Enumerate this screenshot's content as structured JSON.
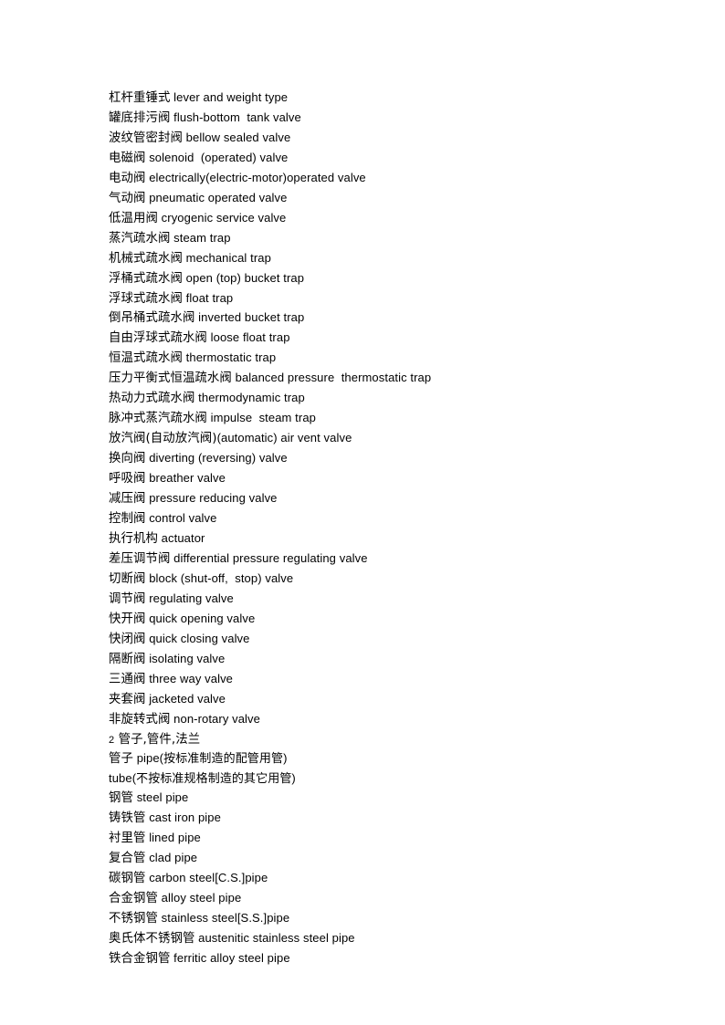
{
  "document": {
    "background_color": "#ffffff",
    "text_color": "#000000",
    "lines": [
      {
        "term": "杠杆重锤式",
        "gloss": " lever and weight type"
      },
      {
        "term": "罐底排污阀",
        "gloss": " flush-bottom  tank valve"
      },
      {
        "term": "波纹管密封阀",
        "gloss": " bellow sealed valve"
      },
      {
        "term": "电磁阀",
        "gloss": " solenoid  (operated) valve"
      },
      {
        "term": "电动阀",
        "gloss": " electrically(electric-motor)operated valve"
      },
      {
        "term": "气动阀",
        "gloss": " pneumatic operated valve"
      },
      {
        "term": "低温用阀",
        "gloss": " cryogenic service valve"
      },
      {
        "term": "蒸汽疏水阀",
        "gloss": " steam trap"
      },
      {
        "term": "机械式疏水阀",
        "gloss": " mechanical trap"
      },
      {
        "term": "浮桶式疏水阀",
        "gloss": " open (top) bucket trap"
      },
      {
        "term": "浮球式疏水阀",
        "gloss": " float trap"
      },
      {
        "term": "倒吊桶式疏水阀",
        "gloss": " inverted bucket trap"
      },
      {
        "term": "自由浮球式疏水阀",
        "gloss": " loose float trap"
      },
      {
        "term": "恒温式疏水阀",
        "gloss": " thermostatic trap"
      },
      {
        "term": "压力平衡式恒温疏水阀",
        "gloss": " balanced pressure  thermostatic trap"
      },
      {
        "term": "热动力式疏水阀",
        "gloss": " thermodynamic trap"
      },
      {
        "term": "脉冲式蒸汽疏水阀",
        "gloss": " impulse  steam trap"
      },
      {
        "term": "放汽阀(自动放汽阀)",
        "gloss": "(automatic) air vent valve"
      },
      {
        "term": "换向阀",
        "gloss": " diverting (reversing) valve"
      },
      {
        "term": "呼吸阀",
        "gloss": " breather valve"
      },
      {
        "term": "减压阀",
        "gloss": " pressure reducing valve"
      },
      {
        "term": "控制阀",
        "gloss": " control valve"
      },
      {
        "term": "执行机构",
        "gloss": " actuator"
      },
      {
        "term": "差压调节阀",
        "gloss": " differential pressure regulating valve"
      },
      {
        "term": "切断阀",
        "gloss": " block (shut-off,  stop) valve"
      },
      {
        "term": "调节阀",
        "gloss": " regulating valve"
      },
      {
        "term": "快开阀",
        "gloss": " quick opening valve"
      },
      {
        "term": "快闭阀",
        "gloss": " quick closing valve"
      },
      {
        "term": "隔断阀",
        "gloss": " isolating valve"
      },
      {
        "term": "三通阀",
        "gloss": " three way valve"
      },
      {
        "term": "夹套阀",
        "gloss": " jacketed valve"
      },
      {
        "term": "非旋转式阀",
        "gloss": " non-rotary valve"
      },
      {
        "heading": true,
        "number": "2",
        "term": " 管子,管件,法兰",
        "gloss": ""
      },
      {
        "term": "管子",
        "gloss": " pipe(按标准制造的配管用管)"
      },
      {
        "term": "",
        "gloss": "tube(不按标准规格制造的其它用管)"
      },
      {
        "term": "钢管",
        "gloss": " steel pipe"
      },
      {
        "term": "铸铁管",
        "gloss": " cast iron pipe"
      },
      {
        "term": "衬里管",
        "gloss": " lined pipe"
      },
      {
        "term": "复合管",
        "gloss": " clad pipe"
      },
      {
        "term": "碳钢管",
        "gloss": " carbon steel[C.S.]pipe"
      },
      {
        "term": "合金钢管",
        "gloss": " alloy steel pipe"
      },
      {
        "term": "不锈钢管",
        "gloss": " stainless steel[S.S.]pipe"
      },
      {
        "term": "奥氏体不锈钢管",
        "gloss": " austenitic stainless steel pipe"
      },
      {
        "term": "铁合金钢管",
        "gloss": " ferritic alloy steel pipe"
      }
    ]
  }
}
